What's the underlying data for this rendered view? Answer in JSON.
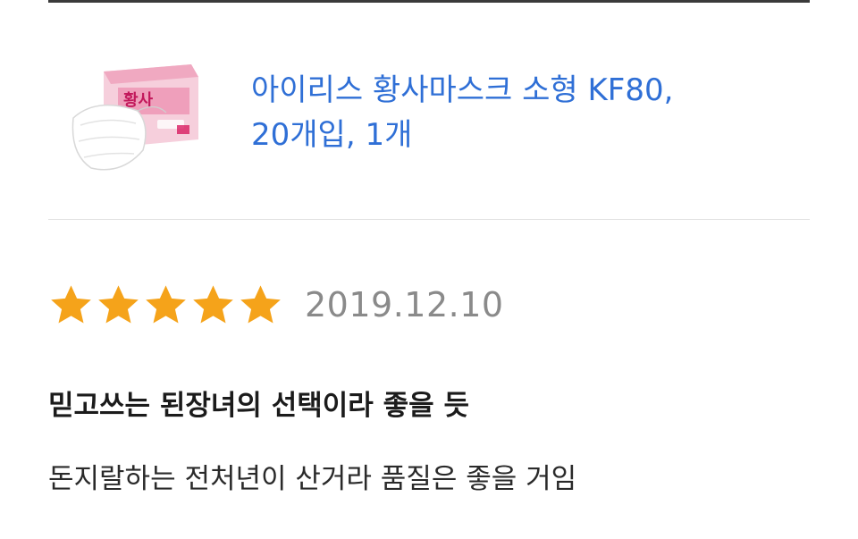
{
  "product": {
    "title_line1": "아이리스 황사마스크 소형 KF80,",
    "title_line2": "20개입, 1개",
    "thumbnail_icon": "mask-product-image"
  },
  "review": {
    "rating": 5,
    "max_rating": 5,
    "star_color": "#f5a31a",
    "date": "2019.12.10",
    "headline": "믿고쓰는 된장녀의 선택이라 좋을 듯",
    "body": "돈지랄하는 전처년이 산거라 품질은 좋을 거임"
  },
  "colors": {
    "link": "#2f6fd6",
    "date": "#8a8a8a"
  }
}
